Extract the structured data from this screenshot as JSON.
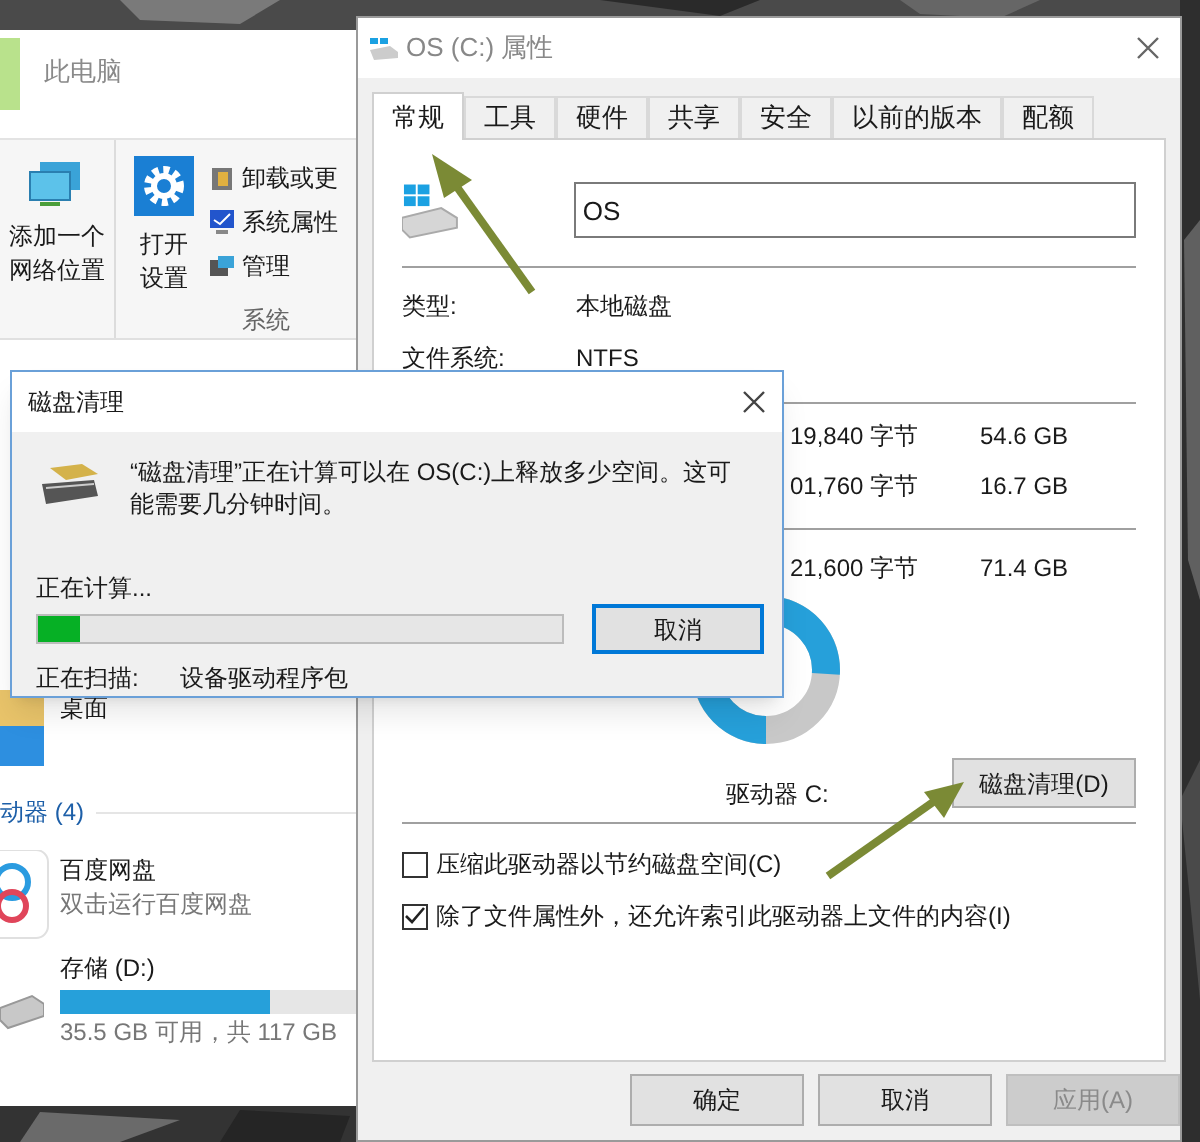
{
  "explorer": {
    "location": "此电脑",
    "ribbon_large": [
      {
        "kind": "network",
        "lines": [
          "添加一个",
          "网络位置"
        ]
      },
      {
        "kind": "settings",
        "lines": [
          "打开",
          "设置"
        ]
      }
    ],
    "ribbon_small": [
      {
        "kind": "uninstall",
        "label": "卸载或更"
      },
      {
        "kind": "properties",
        "label": "系统属性"
      },
      {
        "kind": "manage",
        "label": "管理"
      }
    ],
    "group_label": "系统",
    "nav_item": "桌面",
    "section": "动器 (4)",
    "drives": [
      {
        "kind": "app",
        "name": "百度网盘",
        "detail": "双击运行百度网盘"
      },
      {
        "kind": "disk",
        "name": "存储 (D:)",
        "level": 0.7,
        "detail": "35.5 GB 可用，共 117 GB"
      }
    ]
  },
  "properties": {
    "title": "OS (C:) 属性",
    "tabs": [
      {
        "label": "常规",
        "selected": true
      },
      {
        "label": "工具",
        "selected": false
      },
      {
        "label": "硬件",
        "selected": false
      },
      {
        "label": "共享",
        "selected": false
      },
      {
        "label": "安全",
        "selected": false
      },
      {
        "label": "以前的版本",
        "selected": false
      },
      {
        "label": "配额",
        "selected": false
      }
    ],
    "name_value": "OS",
    "info": [
      {
        "label": "类型:",
        "value": "本地磁盘"
      },
      {
        "label": "文件系统:",
        "value": "NTFS"
      }
    ],
    "space": [
      {
        "bytes": "19,840 字节",
        "size": "54.6 GB"
      },
      {
        "bytes": "01,760 字节",
        "size": "16.7 GB"
      }
    ],
    "capacity": {
      "bytes": "21,600 字节",
      "size": "71.4 GB"
    },
    "drive_label": "驱动器 C:",
    "cleanup_button": "磁盘清理(D)",
    "options": [
      {
        "label": "压缩此驱动器以节约磁盘空间(C)",
        "checked": false
      },
      {
        "label": "除了文件属性外，还允许索引此驱动器上文件的内容(I)",
        "checked": true
      }
    ],
    "buttons": [
      {
        "label": "确定",
        "disabled": false
      },
      {
        "label": "取消",
        "disabled": false
      },
      {
        "label": "应用(A)",
        "disabled": true
      }
    ]
  },
  "cleanup": {
    "title": "磁盘清理",
    "message": "“磁盘清理”正在计算可以在 OS(C:)上释放多少空间。这可能需要几分钟时间。",
    "status": "正在计算...",
    "level": 0.08,
    "cancel": "取消",
    "scanning_label": "正在扫描:",
    "scanning_value": "设备驱动程序包"
  }
}
